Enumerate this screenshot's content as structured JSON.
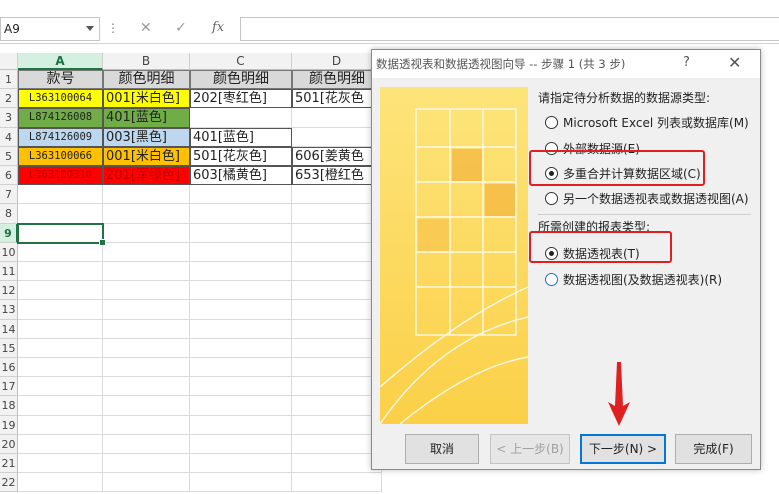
{
  "formula_bar": {
    "name_box": "A9",
    "separator": "⋮",
    "cancel_icon": "✕",
    "enter_icon": "✓",
    "fx_label": "fx",
    "formula": ""
  },
  "columns": [
    "A",
    "B",
    "C",
    "D"
  ],
  "rows": [
    "1",
    "2",
    "3",
    "4",
    "5",
    "6",
    "7",
    "8",
    "9",
    "10",
    "11",
    "12",
    "13",
    "14",
    "15",
    "16",
    "17",
    "18",
    "19",
    "20",
    "21",
    "22"
  ],
  "sheet": {
    "header": [
      "款号",
      "颜色明细",
      "颜色明细",
      "颜色明细"
    ],
    "data": [
      {
        "a": "L363100064",
        "b": "001[米白色]",
        "c": "202[枣红色]",
        "d": "501[花灰色"
      },
      {
        "a": "L874126008",
        "b": "401[蓝色]",
        "c": "",
        "d": ""
      },
      {
        "a": "L874126009",
        "b": "003[黑色]",
        "c": "401[蓝色]",
        "d": ""
      },
      {
        "a": "L363100066",
        "b": "001[米白色]",
        "c": "501[花灰色]",
        "d": "606[姜黄色"
      },
      {
        "a": "L363100310",
        "b": "201[军绿色]",
        "c": "603[橘黄色]",
        "d": "653[橙红色"
      }
    ],
    "row_colors": [
      "#ffff00",
      "#70ad47",
      "#bdd7ee",
      "#ffc000",
      "#ff0000"
    ]
  },
  "dialog": {
    "title": "数据透视表和数据透视图向导 -- 步骤 1 (共 3 步)",
    "help": "?",
    "close": "✕",
    "section1": "请指定待分析数据的数据源类型:",
    "source_options": [
      {
        "label": "Microsoft Excel 列表或数据库(M)",
        "selected": false
      },
      {
        "label": "外部数据源(E)",
        "selected": false
      },
      {
        "label": "多重合并计算数据区域(C)",
        "selected": true
      },
      {
        "label": "另一个数据透视表或数据透视图(A)",
        "selected": false
      }
    ],
    "section2": "所需创建的报表类型:",
    "report_options": [
      {
        "label": "数据透视表(T)",
        "selected": true
      },
      {
        "label": "数据透视图(及数据透视表)(R)",
        "selected": false
      }
    ],
    "buttons": {
      "cancel": "取消",
      "back": "< 上一步(B)",
      "next": "下一步(N) >",
      "finish": "完成(F)"
    }
  },
  "colors": {
    "highlight": "#e02020",
    "accent": "#217346",
    "focus": "#0078d7"
  }
}
